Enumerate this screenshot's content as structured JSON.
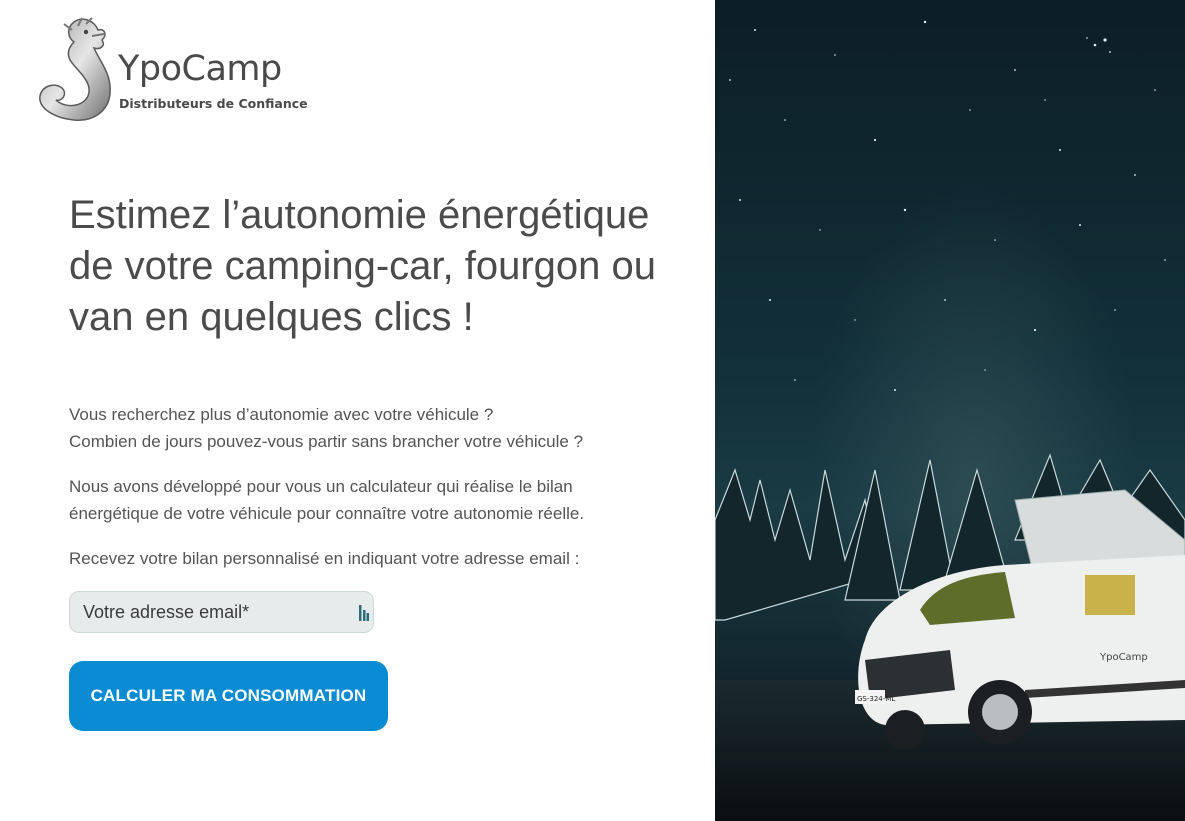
{
  "brand": {
    "name": "YpoCamp",
    "tagline": "Distributeurs de Confiance"
  },
  "hero": {
    "title": "Estimez l’autonomie énergétique de votre camping-car, fourgon ou van en quelques clics !",
    "intro_line1": "Vous recherchez plus d’autonomie avec votre véhicule ?",
    "intro_line2": "Combien de jours pouvez-vous partir sans brancher votre véhicule ?",
    "desc_line1": "Nous avons développé pour vous un calculateur qui réalise le bilan",
    "desc_line2": "énergétique de votre véhicule pour connaître votre autonomie réelle.",
    "cta_intro": "Recevez votre bilan personnalisé en indiquant votre adresse email :"
  },
  "form": {
    "email_placeholder": "Votre adresse email*",
    "email_value": "",
    "submit_label": "CALCULER MA CONSOMMATION"
  },
  "image": {
    "van_brand": "YpoCamp",
    "plate": "GS-324-ML"
  },
  "colors": {
    "accent": "#0b8bd1",
    "text": "#4b4b4b",
    "input_bg": "#e7ebec"
  }
}
